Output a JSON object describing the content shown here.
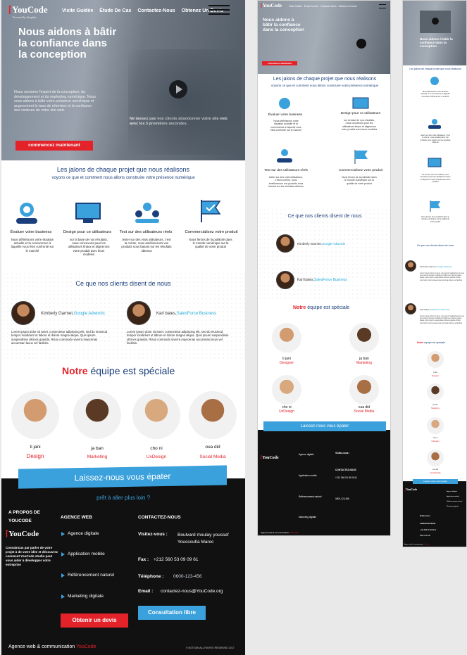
{
  "brand": {
    "logo": "YouCode",
    "tagline": "Powered by Simplon",
    "accent": "#e3222a",
    "blue": "#3aa1dc",
    "navy": "#1a3f7a"
  },
  "nav": {
    "items": [
      "Visite Guidée",
      "Étude De Cas",
      "Contactez-Nous",
      "Obtenez Un Devis"
    ]
  },
  "hero": {
    "title": "Nous aidons à bâtir la confiance dans la conception",
    "paragraph": "Nous sommes l'expert de la conception, du développement et du marketing numérique. Nous vous aidons à bâtir votre présence numérique et augmentent le taux de rétention et la confiance des visiteurs de votre site web.",
    "video_note": "Ne laissez pas vos clients abandonner votre site web avec les 3 premières secondes.",
    "cta": "commencez maintenant"
  },
  "steps": {
    "title": "Les jalons de chaque projet que nous réalisons",
    "subtitle": "voyons ce que et comment nous allons construire votre présence numérique",
    "items": [
      {
        "title": "Évaluer votre business",
        "text": "Nous définissons votre situation actuelle et la concurrence à laquelle vous êtes confronté sur le marché"
      },
      {
        "title": "Design pour ce utilisateurs",
        "text": "sur la base de nos résultats, nous concevons pour les utilisateurs finaux et alignerons votre produit avec leurs modèles"
      },
      {
        "title": "Test sur des utilisateurs réels",
        "text": "tester sur des vrais utilisateurs, c'est la crème, nous améliorerons vos produits nous basant sur les résultats obtenus"
      },
      {
        "title": "Commercialisez votre produit",
        "text": "Nous ferons de la publicité dans le monde numérique sur la qualité de votre produit"
      }
    ]
  },
  "testimonials": {
    "title": "Ce que nos clients disent de nous",
    "items": [
      {
        "name": "Kimberly Garmet,",
        "company": "Google Adwords",
        "text": "Lorem ipsum dolor sit amet, consectetur adipiscing elit, sed do eiusmod tempor incididunt ut labore et dolore magna aliqua. Quis ipsum suspendisse ultrices gravida. Risus commodo viverra maecenas accumsan lacus vel facilisis."
      },
      {
        "name": "Karl bates,",
        "company": "SalesForce Business",
        "text": "Lorem ipsum dolor sit amet, consectetur adipiscing elit, sed do eiusmod tempor incididunt ut labore et dolore magna aliqua. Quis ipsum suspendisse ultrices gravida. Risus commodo viverra maecenas accumsan lacus vel facilisis."
      }
    ]
  },
  "team": {
    "title_red": "Notre",
    "title_rest": "équipe est spéciale",
    "members": [
      {
        "name": "ti jani",
        "role": "Design"
      },
      {
        "name": "ja ban",
        "role": "Marketing"
      },
      {
        "name": "cho ni",
        "role": "UxDesign"
      },
      {
        "name": "oua did",
        "role": "Social Media"
      }
    ],
    "tablet_members": [
      {
        "name": "ti jani",
        "role": "Designer"
      },
      {
        "name": "ja ban",
        "role": "Marketing"
      },
      {
        "name": "cho ni",
        "role": "UxDesign"
      },
      {
        "name": "oua did",
        "role": "Social Media"
      }
    ]
  },
  "banner": {
    "text": "Laissez-nous vous épater",
    "sub": "prêt à aller plus loin ?"
  },
  "footer": {
    "about_title": "A PROPOS DE YOUCODE",
    "about_text": "Convaincus par parler de votre projet à de votre idée et découvrez comment YouCode studio peut vous aider à développer votre entreprise",
    "agency_title": "AGENCE WEB",
    "services": [
      "Agence digitale",
      "Application mobile",
      "Référencement naturel",
      "Marketing digitale"
    ],
    "contact_title": "CONTACTEZ-NOUS",
    "visit_label": "Visitez-vous :",
    "visit_value": "Boulvard moulay youssef Youssoufia Maroc",
    "fax_label": "Fax :",
    "fax_value": "+212 560 53 09 09 61",
    "tel_label": "Téléphone :",
    "tel_value": "0600-123-456",
    "email_label": "Email :",
    "email_value": "contactez-nous@YouCode.org",
    "quote_btn": "Obtenir un devis",
    "consult_btn": "Consultation libre",
    "bottom_left": "Agence web & communication",
    "bottom_brand": "YouCode",
    "rights": "© NOTGEN ALL RIGHTS RESERVED 2017"
  }
}
